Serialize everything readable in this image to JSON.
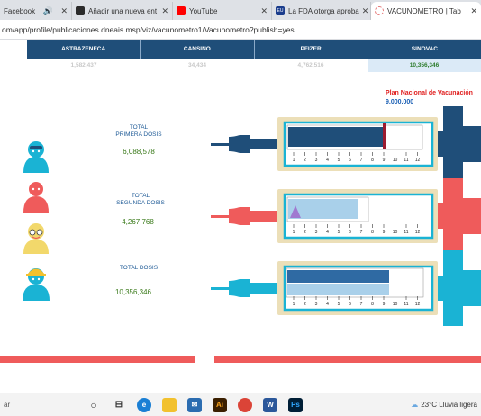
{
  "browser": {
    "tabs": [
      {
        "label": "Facebook",
        "active": false
      },
      {
        "label": "Añadir una nueva ent",
        "active": false
      },
      {
        "label": "YouTube",
        "active": false
      },
      {
        "label": "La FDA otorga aproba",
        "active": false
      },
      {
        "label": "VACUNOMETRO | Tab",
        "active": true
      }
    ],
    "url_host": "om/app/profile/publicaciones.dneais.msp/viz/vacunometro1/Vacunometro?publish=yes"
  },
  "table": {
    "headers": [
      "ASTRAZENECA",
      "CANSINO",
      "PFIZER",
      "SINOVAC"
    ],
    "values": [
      "1,582,437",
      "34,434",
      "4,762,516",
      "10,356,346"
    ]
  },
  "plan": {
    "title": "Plan Nacional de Vacunación",
    "target": "9.000.000"
  },
  "sections": [
    {
      "label_line1": "TOTAL",
      "label_line2": "PRIMERA DOSIS",
      "value": "6,088,578",
      "fill_fraction": 0.7
    },
    {
      "label_line1": "TOTAL",
      "label_line2": "SEGUNDA DOSIS",
      "value": "4,267,768",
      "fill_fraction": 0.52
    },
    {
      "label_line1": "TOTAL DOSIS",
      "label_line2": "",
      "value": "10,356,346",
      "fill_fraction": 0.75
    }
  ],
  "scale_ticks": [
    "1",
    "2",
    "3",
    "4",
    "5",
    "6",
    "7",
    "8",
    "9",
    "10",
    "11",
    "12"
  ],
  "taskbar": {
    "search": "ar",
    "weather": "23°C  Lluvia ligera"
  },
  "colors": {
    "navy": "#1f4e79",
    "red": "#ef5b5b",
    "teal": "#1ab3d4",
    "frame": "#ecdfb8",
    "green": "#3a7a1a"
  }
}
